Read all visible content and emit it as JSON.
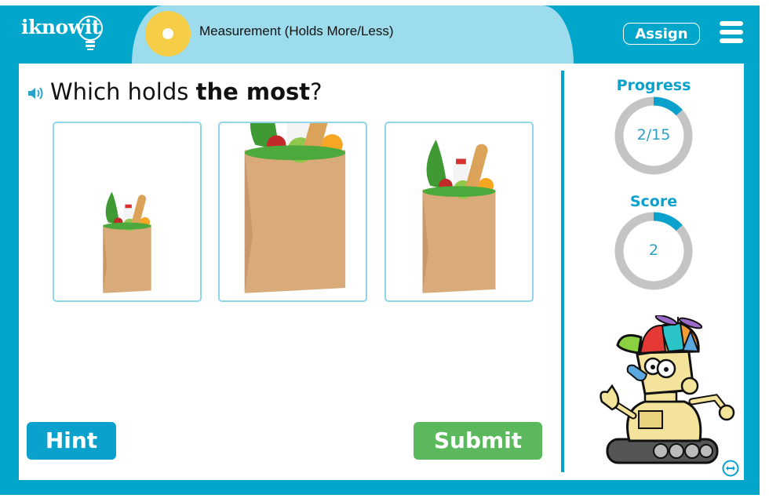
{
  "header": {
    "logo_text": "iknowit",
    "topic_title": "Measurement (Holds More/Less)",
    "topic_icon": "yellow-circle-icon",
    "assign_label": "Assign",
    "menu_icon": "hamburger-menu-icon"
  },
  "question": {
    "audio_icon": "speaker-icon",
    "prefix": "Which holds ",
    "emphasis": "the most",
    "suffix": "?"
  },
  "answers": [
    {
      "id": "option-small",
      "description": "small grocery bag",
      "relative_size": "small"
    },
    {
      "id": "option-large",
      "description": "large grocery bag",
      "relative_size": "large"
    },
    {
      "id": "option-medium",
      "description": "medium grocery bag",
      "relative_size": "medium"
    }
  ],
  "buttons": {
    "hint_label": "Hint",
    "submit_label": "Submit"
  },
  "sidebar": {
    "progress_label": "Progress",
    "progress_text": "2/15",
    "progress_value": 2,
    "progress_total": 15,
    "score_label": "Score",
    "score_text": "2",
    "score_fraction": 0.133,
    "mascot": "robot-mascot",
    "swap_icon": "swap-horizontal-icon"
  },
  "colors": {
    "frame": "#03a6cb",
    "title_pill": "#9ddcec",
    "topic_icon": "#f5cd47",
    "accent_blue": "#0aa1cc",
    "submit_green": "#5bb85d",
    "ring_gray": "#c4c4c4",
    "card_border": "#8fd6ea"
  }
}
